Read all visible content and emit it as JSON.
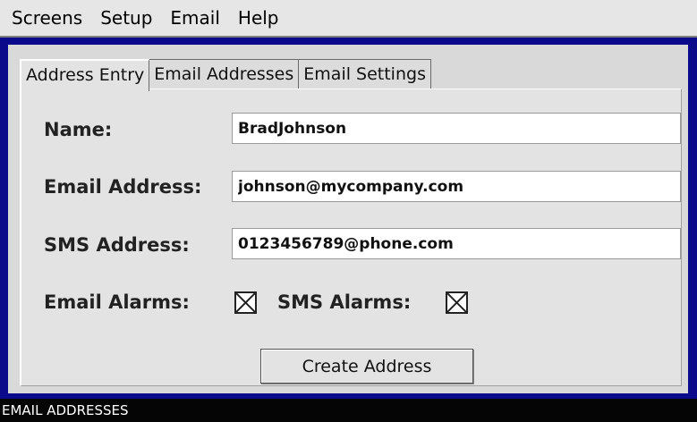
{
  "menu": [
    "Screens",
    "Setup",
    "Email",
    "Help"
  ],
  "tabs": [
    {
      "label": "Address Entry",
      "active": true
    },
    {
      "label": "Email Addresses",
      "active": false
    },
    {
      "label": "Email Settings",
      "active": false
    }
  ],
  "form": {
    "name_label": "Name:",
    "name_value": "BradJohnson",
    "email_label": "Email Address:",
    "email_value": "johnson@mycompany.com",
    "sms_label": "SMS Address:",
    "sms_value": "0123456789@phone.com",
    "email_alarms_label": "Email Alarms:",
    "email_alarms_checked": true,
    "sms_alarms_label": "SMS Alarms:",
    "sms_alarms_checked": true,
    "create_button": "Create Address"
  },
  "status": {
    "text": "EMAIL ADDRESSES"
  },
  "colors": {
    "background": "#0a0a8a",
    "status_bar": "#050505",
    "panel": "#e3e3e3"
  }
}
